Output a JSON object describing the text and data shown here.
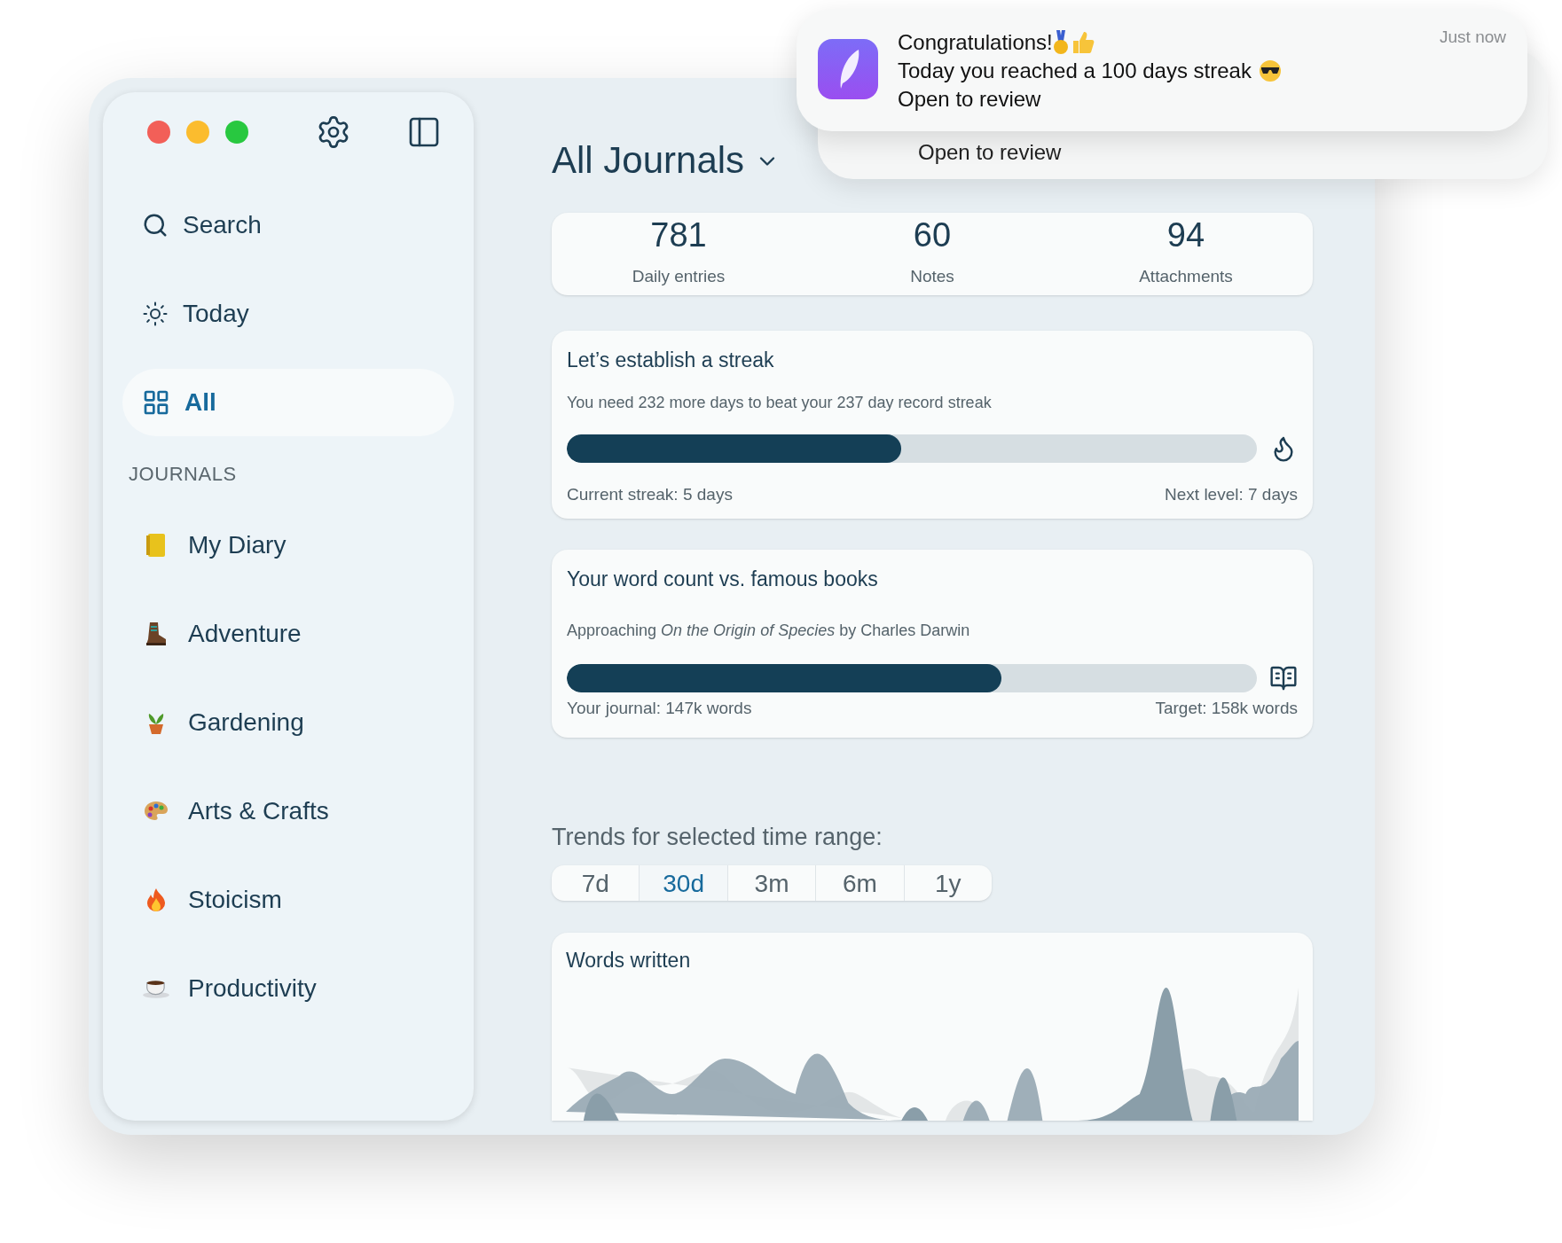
{
  "notifications": [
    {
      "title": "Congratulations!",
      "message": "Today you reached a 100 days streak",
      "action": "Open to review",
      "time": "Just now"
    }
  ],
  "notification_behind": {
    "action": "Open to review"
  },
  "sidebar": {
    "nav": [
      {
        "label": "Search",
        "selected": false
      },
      {
        "label": "Today",
        "selected": false
      },
      {
        "label": "All",
        "selected": true
      }
    ],
    "section_title": "JOURNALS",
    "journals": [
      {
        "label": "My Diary"
      },
      {
        "label": "Adventure"
      },
      {
        "label": "Gardening"
      },
      {
        "label": "Arts & Crafts"
      },
      {
        "label": "Stoicism"
      },
      {
        "label": "Productivity"
      }
    ]
  },
  "header": {
    "title": "All Journals"
  },
  "stats": [
    {
      "value": "781",
      "label": "Daily entries"
    },
    {
      "value": "60",
      "label": "Notes"
    },
    {
      "value": "94",
      "label": "Attachments"
    }
  ],
  "streak": {
    "title": "Let’s establish a streak",
    "subtitle": "You need 232 more days to beat your 237 day record streak",
    "level": 0.485,
    "left": "Current streak: 5 days",
    "right": "Next level: 7 days"
  },
  "words": {
    "title": "Your word count vs. famous books",
    "subtitle": "Approaching *On the Origin of Species* by Charles Darwin",
    "level": 0.63,
    "left": "Your journal: 147k words",
    "right": "Target: 158k words"
  },
  "trends": {
    "label": "Trends for selected time range:",
    "ranges": [
      {
        "label": "7d",
        "selected": false
      },
      {
        "label": "30d",
        "selected": true
      },
      {
        "label": "3m",
        "selected": false
      },
      {
        "label": "6m",
        "selected": false
      },
      {
        "label": "1y",
        "selected": false
      }
    ]
  },
  "chart": {
    "title": "Words written"
  }
}
